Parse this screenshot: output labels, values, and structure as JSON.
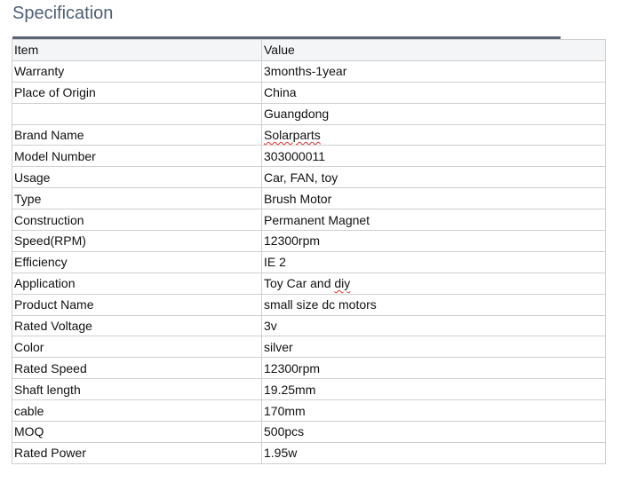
{
  "page": {
    "title": "Specification"
  },
  "table": {
    "headers": [
      "Item",
      "Value"
    ],
    "rows": [
      {
        "item": "Warranty",
        "value": "3months-1year"
      },
      {
        "item": "Place of Origin",
        "value": "China"
      },
      {
        "item": "",
        "value": "Guangdong"
      },
      {
        "item": "Brand Name",
        "value": "Solarparts"
      },
      {
        "item": "Model Number",
        "value": "303000011"
      },
      {
        "item": "Usage",
        "value": "Car, FAN, toy"
      },
      {
        "item": "Type",
        "value": "Brush Motor"
      },
      {
        "item": "Construction",
        "value": "Permanent Magnet"
      },
      {
        "item": "Speed(RPM)",
        "value": "12300rpm"
      },
      {
        "item": "Efficiency",
        "value": "IE 2"
      },
      {
        "item": "Application",
        "value_prefix": "Toy Car and ",
        "value_flagged": "diy"
      },
      {
        "item": "Product Name",
        "value": "small size dc motors"
      },
      {
        "item": "Rated Voltage",
        "value": "3v"
      },
      {
        "item": "Color",
        "value": "silver"
      },
      {
        "item": "Rated Speed",
        "value": "12300rpm"
      },
      {
        "item": "Shaft length",
        "value": "19.25mm"
      },
      {
        "item": "cable",
        "value": "170mm"
      },
      {
        "item": "MOQ",
        "value": "500pcs"
      },
      {
        "item": "Rated Power",
        "value": "1.95w"
      }
    ]
  }
}
